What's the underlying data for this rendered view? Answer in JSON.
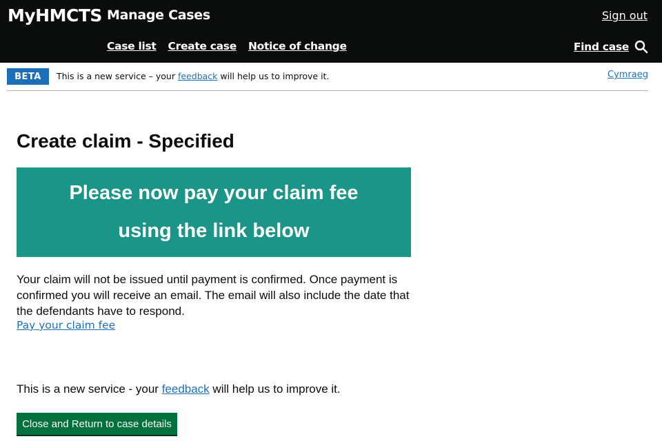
{
  "header": {
    "brand": "MyHMCTS",
    "service_name": "Manage Cases",
    "sign_out": "Sign out",
    "nav": {
      "case_list": "Case list",
      "create_case": "Create case",
      "notice_of_change": "Notice of change"
    },
    "find_case": "Find case",
    "find_case_icon": "search-icon"
  },
  "beta_banner": {
    "tag": "BETA",
    "text_before": "This is a new service – your ",
    "link": "feedback",
    "text_after": " will help us to improve it.",
    "language_toggle": "Cymraeg"
  },
  "main": {
    "title": "Create claim - Specified",
    "panel": {
      "line1": "Please now pay your claim fee",
      "line2": "using the link below",
      "background": "#1a9588"
    },
    "body": "Your claim will not be issued until payment is confirmed. Once payment is confirmed you will receive an email. The email will also include the date that the defendants have to respond.",
    "pay_link": "Pay your claim fee",
    "feedback": {
      "before": "This is a new service - your ",
      "link": "feedback",
      "after": " will help us to improve it."
    },
    "close_button": "Close and Return to case details"
  },
  "colors": {
    "header_bg": "#0b0c0c",
    "link": "#1d70b8",
    "button": "#00703c",
    "beta_tag": "#1d70b8"
  }
}
